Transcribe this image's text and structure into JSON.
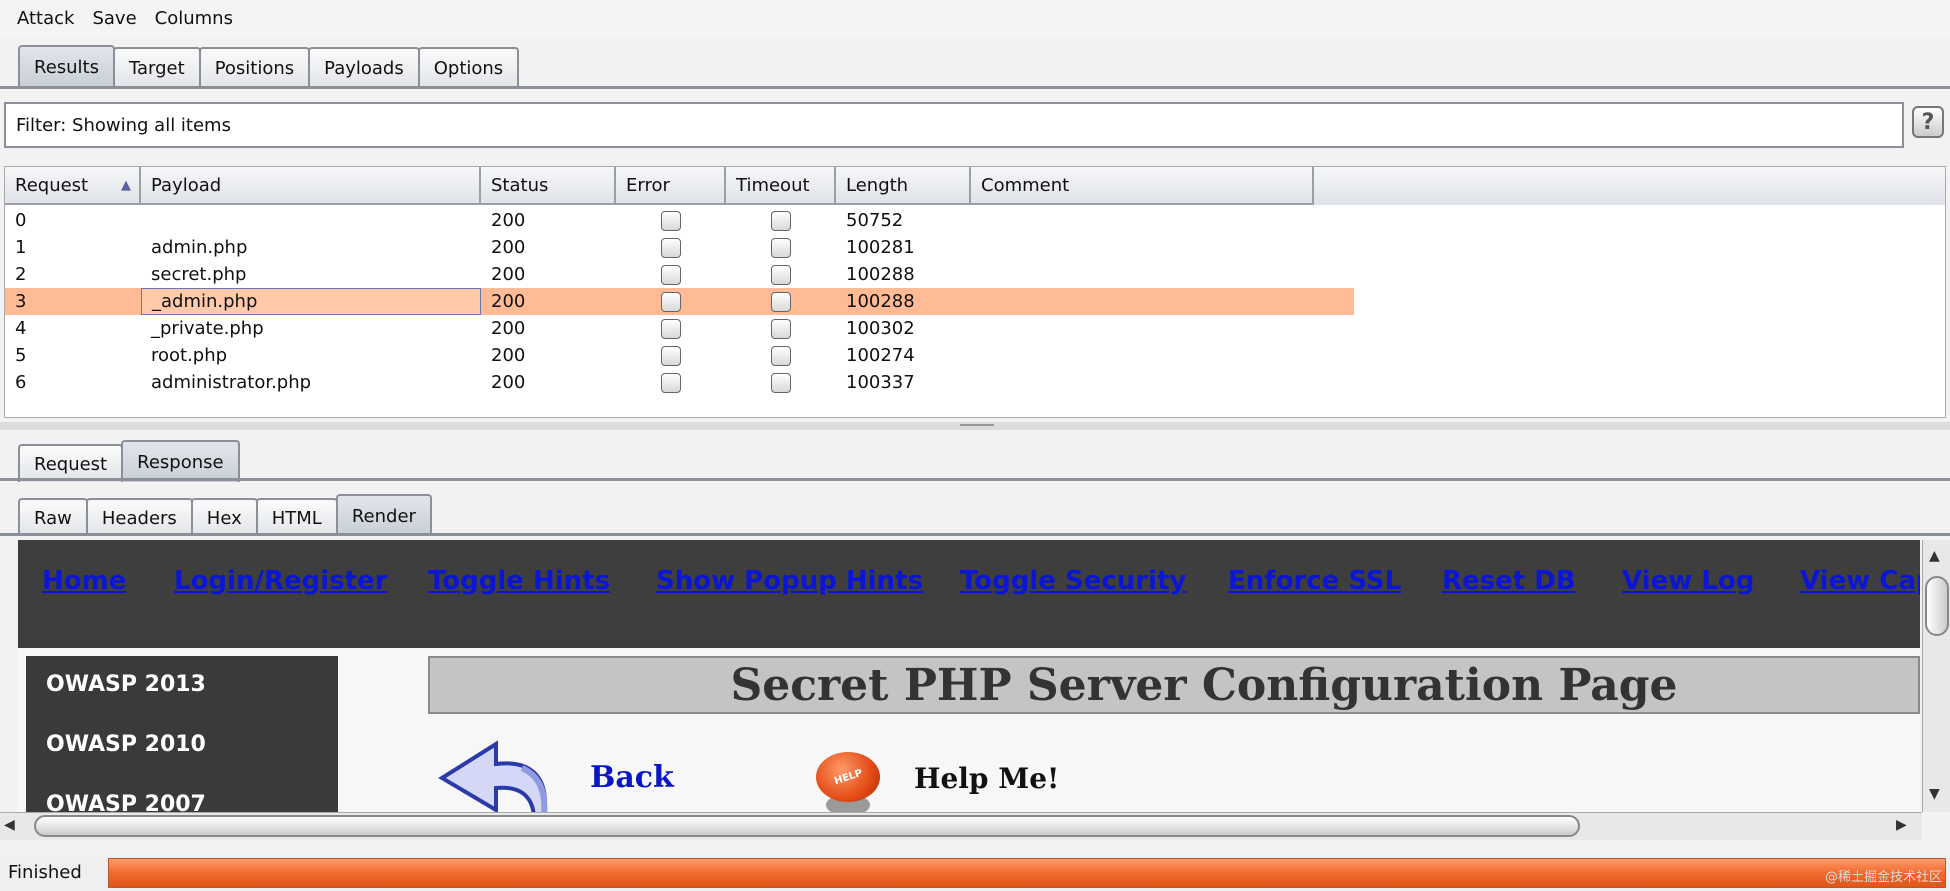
{
  "menu": [
    "Attack",
    "Save",
    "Columns"
  ],
  "main_tabs": [
    {
      "label": "Results",
      "selected": true
    },
    {
      "label": "Target"
    },
    {
      "label": "Positions"
    },
    {
      "label": "Payloads"
    },
    {
      "label": "Options"
    }
  ],
  "filter": {
    "text": "Filter: Showing all items",
    "help": "?"
  },
  "table": {
    "columns": [
      "Request",
      "Payload",
      "Status",
      "Error",
      "Timeout",
      "Length",
      "Comment"
    ],
    "sort_indicator": "▲",
    "rows": [
      {
        "request": "0",
        "payload": "",
        "status": "200",
        "error": false,
        "timeout": false,
        "length": "50752",
        "comment": ""
      },
      {
        "request": "1",
        "payload": "admin.php",
        "status": "200",
        "error": false,
        "timeout": false,
        "length": "100281",
        "comment": ""
      },
      {
        "request": "2",
        "payload": "secret.php",
        "status": "200",
        "error": false,
        "timeout": false,
        "length": "100288",
        "comment": ""
      },
      {
        "request": "3",
        "payload": "_admin.php",
        "status": "200",
        "error": false,
        "timeout": false,
        "length": "100288",
        "comment": "",
        "selected": true
      },
      {
        "request": "4",
        "payload": "_private.php",
        "status": "200",
        "error": false,
        "timeout": false,
        "length": "100302",
        "comment": ""
      },
      {
        "request": "5",
        "payload": "root.php",
        "status": "200",
        "error": false,
        "timeout": false,
        "length": "100274",
        "comment": ""
      },
      {
        "request": "6",
        "payload": "administrator.php",
        "status": "200",
        "error": false,
        "timeout": false,
        "length": "100337",
        "comment": ""
      }
    ]
  },
  "rr_tabs": [
    {
      "label": "Request"
    },
    {
      "label": "Response",
      "selected": true
    }
  ],
  "view_tabs": [
    {
      "label": "Raw"
    },
    {
      "label": "Headers"
    },
    {
      "label": "Hex"
    },
    {
      "label": "HTML"
    },
    {
      "label": "Render",
      "selected": true
    }
  ],
  "rendered": {
    "nav": [
      "Home",
      "Login/Register",
      "Toggle Hints",
      "Show Popup Hints",
      "Toggle Security",
      "Enforce SSL",
      "Reset DB",
      "View Log",
      "View Cap"
    ],
    "sidebar": [
      "OWASP 2013",
      "OWASP 2010",
      "OWASP 2007"
    ],
    "title": "Secret PHP Server Configuration Page",
    "back": "Back",
    "help": "Help Me!",
    "help_button_text": "HELP"
  },
  "status": {
    "text": "Finished",
    "watermark": "@稀土掘金技术社区",
    "progress": 1.0,
    "bar_color": "#f26a2e"
  }
}
